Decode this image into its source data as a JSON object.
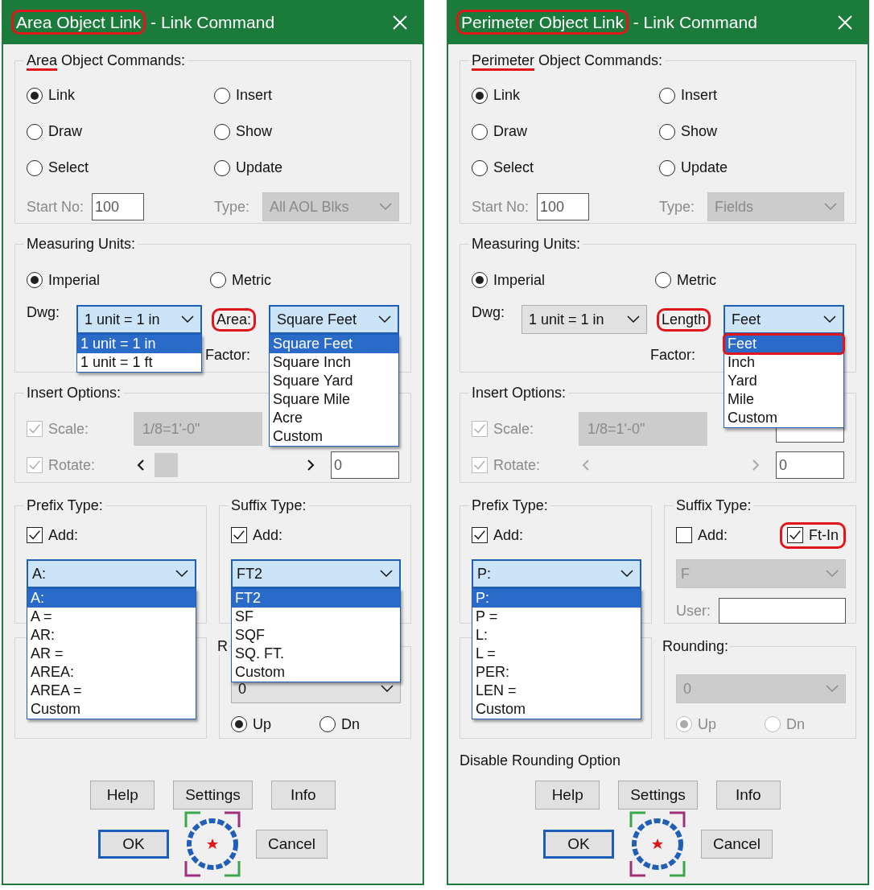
{
  "dialogs": [
    {
      "title": {
        "main": "Area Object Link",
        "rest": " - Link Command",
        "circled": true
      },
      "commands": {
        "label_marked": "Area",
        "label_rest": " Object Commands:",
        "underlined": true,
        "radios": [
          {
            "label": "Link",
            "selected": true
          },
          {
            "label": "Insert",
            "selected": false
          },
          {
            "label": "Draw",
            "selected": false
          },
          {
            "label": "Show",
            "selected": false
          },
          {
            "label": "Select",
            "selected": false
          },
          {
            "label": "Update",
            "selected": false
          }
        ],
        "start_no": {
          "label": "Start No:",
          "value": "100",
          "disabled": true
        },
        "type": {
          "label": "Type:",
          "value": "All AOL Blks",
          "disabled": true
        }
      },
      "units": {
        "label": "Measuring Units:",
        "systems": [
          {
            "label": "Imperial",
            "selected": true
          },
          {
            "label": "Metric",
            "selected": false
          }
        ],
        "dwg": {
          "label": "Dwg:",
          "value": "1 unit = 1 in",
          "expanded": true,
          "options": [
            {
              "label": "1 unit = 1 in",
              "selected": true
            },
            {
              "label": "1 unit = 1 ft",
              "selected": false
            }
          ]
        },
        "measure": {
          "label": "Area:",
          "circled": true,
          "value": "Square Feet",
          "expanded": true,
          "options": [
            {
              "label": "Square Feet",
              "selected": true
            },
            {
              "label": "Square Inch",
              "selected": false
            },
            {
              "label": "Square Yard",
              "selected": false
            },
            {
              "label": "Square Mile",
              "selected": false
            },
            {
              "label": "Acre",
              "selected": false
            },
            {
              "label": "Custom",
              "selected": false
            }
          ]
        },
        "factor_label": "Factor:"
      },
      "insert": {
        "label": "Insert Options:",
        "scale": {
          "label": "Scale:",
          "checked": true,
          "disabled": true,
          "value": "1/8=1'-0\""
        },
        "rotate": {
          "label": "Rotate:",
          "checked": true,
          "disabled": true,
          "value": "0",
          "slider_enabled": true
        }
      },
      "prefix": {
        "label": "Prefix Type:",
        "add": {
          "label": "Add:",
          "checked": true
        },
        "combo": {
          "value": "A:",
          "expanded": true,
          "disabled": false,
          "options": [
            {
              "label": "A:",
              "selected": true
            },
            {
              "label": "A =",
              "selected": false
            },
            {
              "label": "AR:",
              "selected": false
            },
            {
              "label": "AR =",
              "selected": false
            },
            {
              "label": "AREA:",
              "selected": false
            },
            {
              "label": "AREA =",
              "selected": false
            },
            {
              "label": "Custom",
              "selected": false
            }
          ]
        }
      },
      "suffix": {
        "label": "Suffix Type:",
        "add": {
          "label": "Add:",
          "checked": true
        },
        "combo": {
          "value": "FT2",
          "expanded": true,
          "disabled": false,
          "options": [
            {
              "label": "FT2",
              "selected": true
            },
            {
              "label": "SF",
              "selected": false
            },
            {
              "label": "SQF",
              "selected": false
            },
            {
              "label": "SQ. FT.",
              "selected": false
            },
            {
              "label": "Custom",
              "selected": false
            }
          ]
        }
      },
      "rounding": {
        "label": "R",
        "value": "0",
        "disabled": false,
        "directions": [
          {
            "label": "Up",
            "selected": true
          },
          {
            "label": "Dn",
            "selected": false
          }
        ]
      },
      "buttons_top": [
        {
          "label": "Help"
        },
        {
          "label": "Settings"
        },
        {
          "label": "Info"
        }
      ],
      "buttons_bottom": [
        {
          "kind": "default",
          "label": "OK"
        },
        {
          "kind": "logo"
        },
        {
          "kind": "normal",
          "label": "Cancel"
        }
      ]
    },
    {
      "title": {
        "main": "Perimeter Object Link",
        "rest": " - Link Command",
        "circled": true
      },
      "commands": {
        "label_marked": "Perimeter",
        "label_rest": " Object Commands:",
        "underlined": true,
        "radios": [
          {
            "label": "Link",
            "selected": true
          },
          {
            "label": "Insert",
            "selected": false
          },
          {
            "label": "Draw",
            "selected": false
          },
          {
            "label": "Show",
            "selected": false
          },
          {
            "label": "Select",
            "selected": false
          },
          {
            "label": "Update",
            "selected": false
          }
        ],
        "start_no": {
          "label": "Start No:",
          "value": "100",
          "disabled": true
        },
        "type": {
          "label": "Type:",
          "value": "Fields",
          "disabled": true
        }
      },
      "units": {
        "label": "Measuring Units:",
        "systems": [
          {
            "label": "Imperial",
            "selected": true
          },
          {
            "label": "Metric",
            "selected": false
          }
        ],
        "dwg": {
          "label": "Dwg:",
          "value": "1 unit = 1 in",
          "expanded": false
        },
        "measure": {
          "label": "Length",
          "circled": true,
          "value": "Feet",
          "expanded": true,
          "options": [
            {
              "label": "Feet",
              "selected": true,
              "circled": true
            },
            {
              "label": "Inch",
              "selected": false,
              "circled": false
            },
            {
              "label": "Yard",
              "selected": false,
              "circled": false
            },
            {
              "label": "Mile",
              "selected": false,
              "circled": false
            },
            {
              "label": "Custom",
              "selected": false,
              "circled": false
            }
          ]
        },
        "factor_label": "Factor:"
      },
      "insert": {
        "label": "Insert Options:",
        "scale": {
          "label": "Scale:",
          "checked": true,
          "disabled": true,
          "value": "1/8=1'-0\""
        },
        "rotate": {
          "label": "Rotate:",
          "checked": true,
          "disabled": true,
          "value": "0",
          "slider_enabled": false
        }
      },
      "prefix": {
        "label": "Prefix Type:",
        "add": {
          "label": "Add:",
          "checked": true
        },
        "combo": {
          "value": "P:",
          "expanded": true,
          "disabled": false,
          "options": [
            {
              "label": "P:",
              "selected": true
            },
            {
              "label": "P =",
              "selected": false
            },
            {
              "label": "L:",
              "selected": false
            },
            {
              "label": "L =",
              "selected": false
            },
            {
              "label": "PER:",
              "selected": false
            },
            {
              "label": "LEN =",
              "selected": false
            },
            {
              "label": "Custom",
              "selected": false
            }
          ]
        }
      },
      "suffix": {
        "label": "Suffix Type:",
        "add": {
          "label": "Add:",
          "checked": false
        },
        "ft_in": {
          "label": "Ft-In",
          "checked": true,
          "circled": true
        },
        "combo": {
          "value": "F",
          "expanded": false,
          "disabled": true
        },
        "user": {
          "label": "User:"
        }
      },
      "rounding": {
        "label": "Rounding:",
        "value": "0",
        "disabled": true,
        "directions": [
          {
            "label": "Up",
            "selected": true
          },
          {
            "label": "Dn",
            "selected": false
          }
        ]
      },
      "note": "Disable Rounding Option",
      "buttons_top": [
        {
          "label": "Help"
        },
        {
          "label": "Settings"
        },
        {
          "label": "Info"
        }
      ],
      "buttons_bottom": [
        {
          "kind": "default",
          "label": "OK"
        },
        {
          "kind": "logo"
        },
        {
          "kind": "normal",
          "label": "Cancel"
        }
      ]
    }
  ]
}
